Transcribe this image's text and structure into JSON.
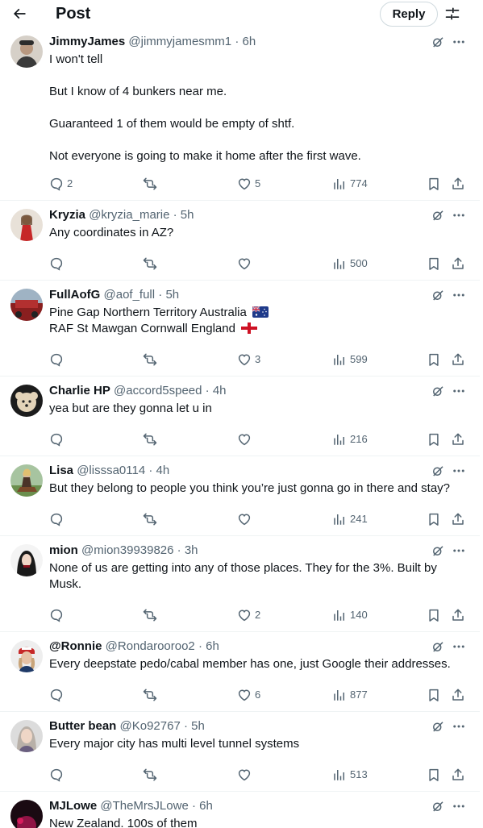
{
  "header": {
    "title": "Post",
    "reply_label": "Reply"
  },
  "icons": {
    "back": "arrow-left-icon",
    "settings": "sliders-icon",
    "grok": "grok-icon",
    "more": "more-icon",
    "reply": "reply-icon",
    "repost": "repost-icon",
    "like": "heart-icon",
    "views": "views-icon",
    "bookmark": "bookmark-icon",
    "share": "share-icon"
  },
  "colors": {
    "text": "#0f1419",
    "secondary": "#536471",
    "divider": "#eff3f4"
  },
  "replies": [
    {
      "name": "JimmyJames",
      "handle": "@jimmyjamesmm1",
      "sep": "·",
      "time": "6h",
      "lines": [
        "I won't tell",
        "But I know of 4 bunkers near me.",
        "Guaranteed 1 of them would be empty of shtf.",
        "Not everyone is going to make it home after the first wave."
      ],
      "replies": "2",
      "reposts": "",
      "likes": "5",
      "views": "774"
    },
    {
      "name": "Kryzia",
      "handle": "@kryzia_marie",
      "sep": "·",
      "time": "5h",
      "lines": [
        "Any coordinates in AZ?"
      ],
      "replies": "",
      "reposts": "",
      "likes": "",
      "views": "500"
    },
    {
      "name": "FullAofG",
      "handle": "@aof_full",
      "sep": "·",
      "time": "5h",
      "lines": [
        "Pine Gap Northern Territory Australia",
        "RAF St Mawgan Cornwall England"
      ],
      "replies": "",
      "reposts": "",
      "likes": "3",
      "views": "599"
    },
    {
      "name": "Charlie HP",
      "handle": "@accord5speed",
      "sep": "·",
      "time": "4h",
      "lines": [
        "yea but are they gonna let u in"
      ],
      "replies": "",
      "reposts": "",
      "likes": "",
      "views": "216"
    },
    {
      "name": "Lisa",
      "handle": "@lisssa0114",
      "sep": "·",
      "time": "4h",
      "lines": [
        "But they belong to people you think you’re just gonna go in there and stay?"
      ],
      "replies": "",
      "reposts": "",
      "likes": "",
      "views": "241"
    },
    {
      "name": "mion",
      "handle": "@mion39939826",
      "sep": "·",
      "time": "3h",
      "lines": [
        "None of us are getting into any of those places. They for the 3%. Built by Musk."
      ],
      "replies": "",
      "reposts": "",
      "likes": "2",
      "views": "140"
    },
    {
      "name": "@Ronnie",
      "handle": "@Rondarooroo2",
      "sep": "·",
      "time": "6h",
      "lines": [
        "Every deepstate pedo/cabal member has one, just Google their addresses."
      ],
      "replies": "",
      "reposts": "",
      "likes": "6",
      "views": "877"
    },
    {
      "name": "Butter bean",
      "handle": "@Ko92767",
      "sep": "·",
      "time": "5h",
      "lines": [
        "Every major city has multi level tunnel systems"
      ],
      "replies": "",
      "reposts": "",
      "likes": "",
      "views": "513"
    },
    {
      "name": "MJLowe",
      "handle": "@TheMrsJLowe",
      "sep": "·",
      "time": "6h",
      "lines": [
        "New Zealand. 100s of them"
      ],
      "replies": "",
      "reposts": "",
      "likes": "",
      "views": ""
    }
  ]
}
